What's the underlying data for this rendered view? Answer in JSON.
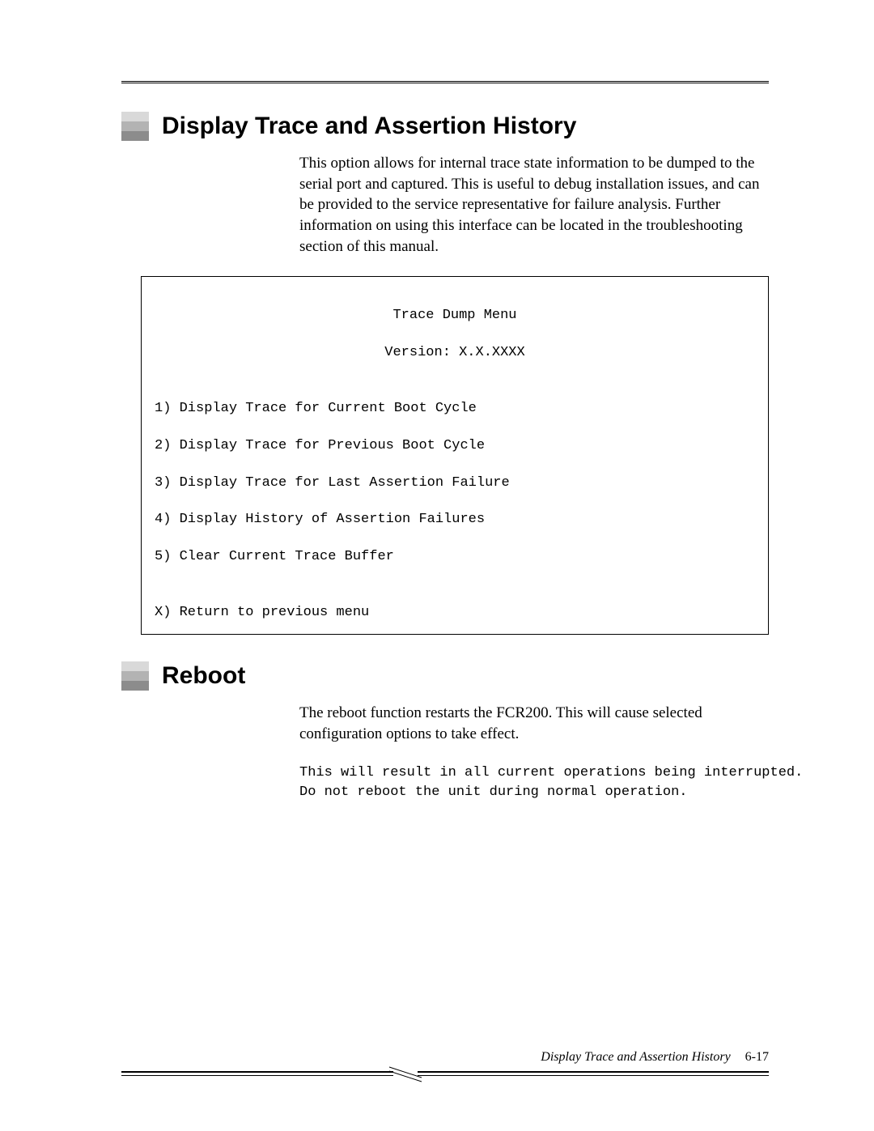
{
  "section1": {
    "heading": "Display Trace and Assertion History",
    "paragraph": "This option allows for internal trace state information to be dumped to the serial port and captured. This is useful to debug installation issues, and can be provided to the service representative for failure analysis. Further information on using this interface can be located in the troubleshooting section of this manual."
  },
  "menu": {
    "title": "Trace Dump Menu",
    "version_line": "Version: X.X.XXXX",
    "items": [
      "1) Display Trace for Current Boot Cycle",
      "2) Display Trace for Previous Boot Cycle",
      "3) Display Trace for Last Assertion Failure",
      "4) Display History of Assertion Failures",
      "5) Clear Current Trace Buffer"
    ],
    "exit": "X) Return to previous menu"
  },
  "section2": {
    "heading": "Reboot",
    "paragraph": "The reboot function restarts the FCR200. This will cause selected configuration options to take effect.",
    "warning_line1": "This will result in all current operations being interrupted.",
    "warning_line2": "Do not reboot the unit during normal operation."
  },
  "footer": {
    "title": "Display Trace and Assertion History",
    "page": "6-17"
  }
}
